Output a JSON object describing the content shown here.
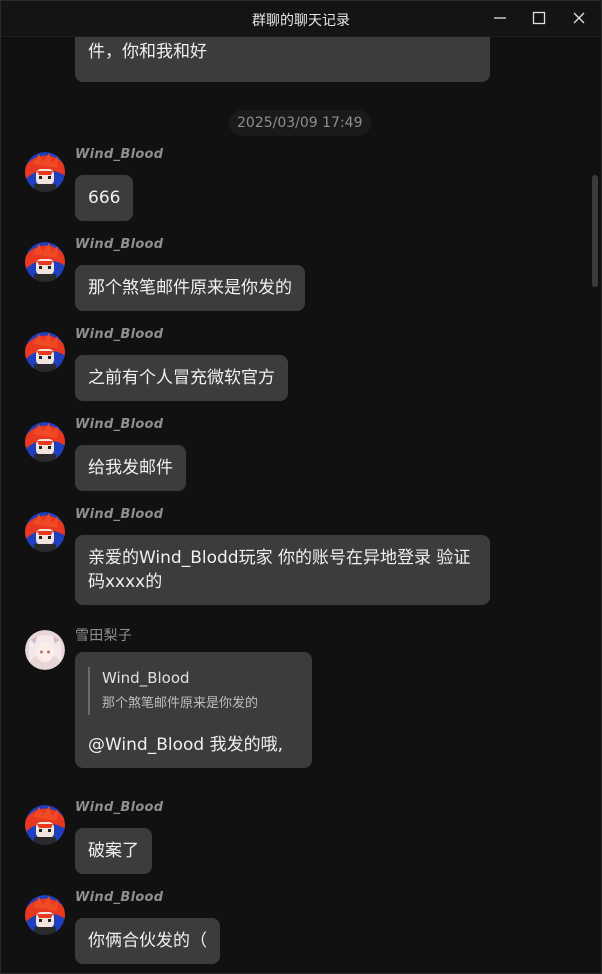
{
  "window": {
    "title": "群聊的聊天记录"
  },
  "top_partial_bubble": {
    "text": "件，你和我和好"
  },
  "timestamp": "2025/03/09 17:49",
  "messages": [
    {
      "sender": "Wind_Blood",
      "text": "666"
    },
    {
      "sender": "Wind_Blood",
      "text": "那个煞笔邮件原来是你发的"
    },
    {
      "sender": "Wind_Blood",
      "text": "之前有个人冒充微软官方"
    },
    {
      "sender": "Wind_Blood",
      "text": "给我发邮件"
    },
    {
      "sender": "Wind_Blood",
      "text": "亲爱的Wind_Blodd玩家 你的账号在异地登录 验证码xxxx的"
    },
    {
      "sender": "雪田梨子",
      "quote_name": "Wind_Blood",
      "quote_text": "那个煞笔邮件原来是你发的",
      "text": "@Wind_Blood 我发的哦,"
    },
    {
      "sender": "Wind_Blood",
      "text": "破案了"
    },
    {
      "sender": "Wind_Blood",
      "text": "你俩合伙发的（"
    }
  ],
  "icons": {
    "minimize": "minimize-icon",
    "maximize": "maximize-icon",
    "close": "close-icon"
  },
  "colors": {
    "background": "#111111",
    "bubble": "#3c3c3c",
    "sender": "#8f8f8f"
  }
}
